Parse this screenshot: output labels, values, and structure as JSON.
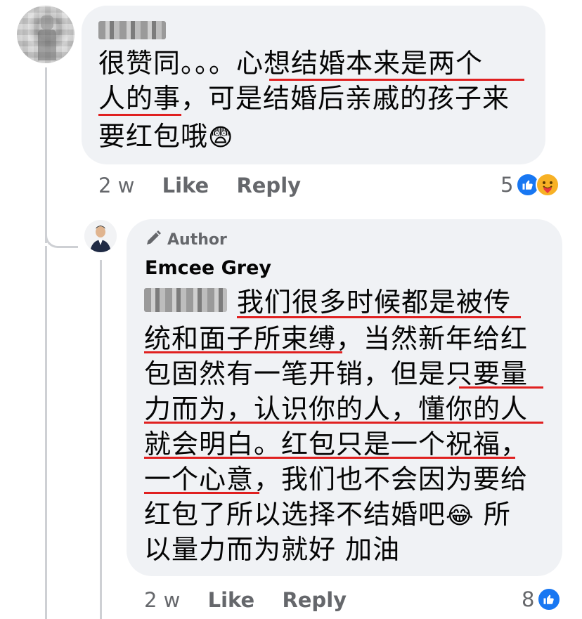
{
  "comment1": {
    "author_redacted": true,
    "lines": [
      "很赞同。。。心想结婚本来是两个",
      "人的事，可是结婚后亲戚的孩子来",
      "要红包哦"
    ],
    "emoji": "😨",
    "time": "2 w",
    "like_label": "Like",
    "reply_label": "Reply",
    "reaction_count": "5",
    "reactions": [
      "like-icon",
      "care-icon"
    ]
  },
  "comment2": {
    "badge_label": "Author",
    "author": "Emcee Grey",
    "mention_redacted": true,
    "lines": [
      "我们很多时候都是被传",
      "统和面子所束缚，当然新年给红",
      "包固然有一笔开销，但是只要量",
      "力而为，认识你的人，懂你的人",
      "就会明白。红包只是一个祝福，",
      "一个心意，我们也不会因为要给",
      "红包了所以选择不结婚吧",
      "以量力而为就好 加油"
    ],
    "line7_emoji": "😂",
    "line7_tail": " 所",
    "time": "2 w",
    "like_label": "Like",
    "reply_label": "Reply",
    "reaction_count": "8",
    "reactions": [
      "like-icon"
    ]
  },
  "colors": {
    "bubble": "#f0f2f5",
    "meta_text": "#65676b",
    "underline": "#e02020",
    "like_blue": "#1877f2"
  }
}
